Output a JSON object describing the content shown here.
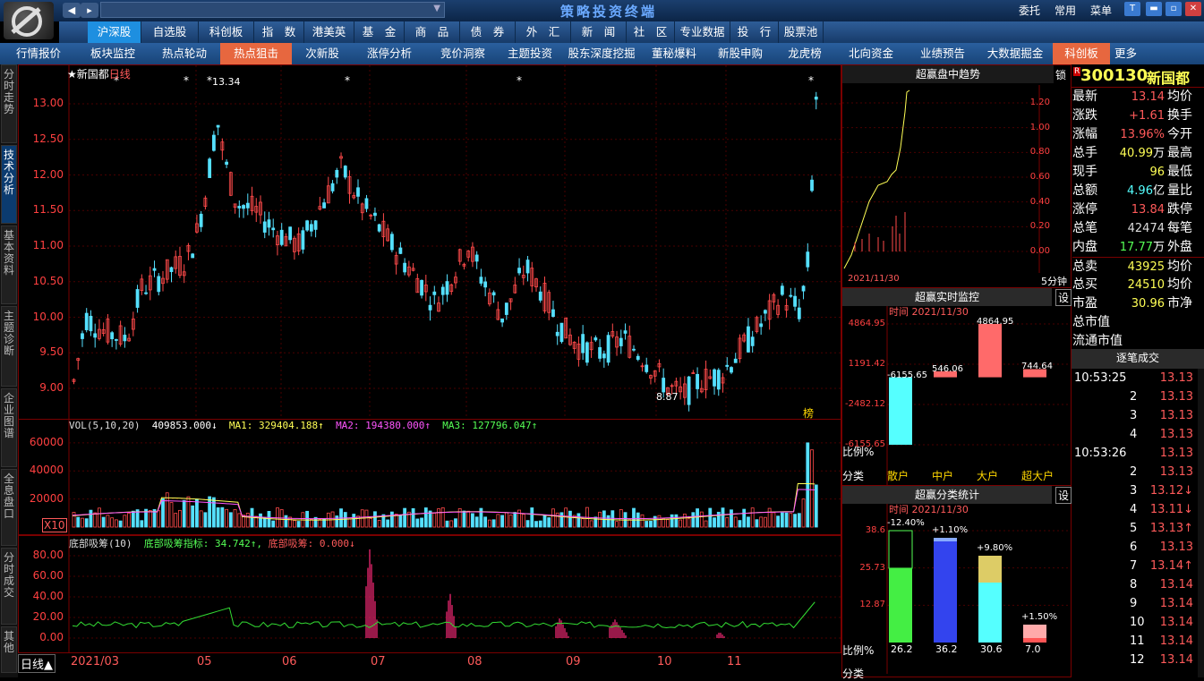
{
  "app": {
    "title": "策略投资终端",
    "right_links": [
      "委托",
      "常用",
      "菜单"
    ]
  },
  "nav1": [
    {
      "label": "沪深股",
      "sel": true
    },
    {
      "label": "自选股"
    },
    {
      "label": "科创板"
    },
    {
      "label": "指　数"
    },
    {
      "label": "港美英"
    },
    {
      "label": "基　金"
    },
    {
      "label": "商　品"
    },
    {
      "label": "债　券"
    },
    {
      "label": "外　汇"
    },
    {
      "label": "新　闻"
    },
    {
      "label": "社　区"
    },
    {
      "label": "专业数据"
    },
    {
      "label": "投　行"
    },
    {
      "label": "股票池"
    }
  ],
  "nav2": [
    {
      "label": "行情报价"
    },
    {
      "label": "板块监控"
    },
    {
      "label": "热点轮动"
    },
    {
      "label": "热点狙击",
      "hot": true
    },
    {
      "label": "次新股"
    },
    {
      "label": "涨停分析"
    },
    {
      "label": "竞价洞察"
    },
    {
      "label": "主题投资"
    },
    {
      "label": "股东深度挖掘"
    },
    {
      "label": "董秘爆料"
    },
    {
      "label": "新股申购"
    },
    {
      "label": "龙虎榜"
    },
    {
      "label": "北向资金"
    },
    {
      "label": "业绩预告"
    },
    {
      "label": "大数据掘金"
    },
    {
      "label": "科创板",
      "hot": true
    },
    {
      "label": "更多"
    }
  ],
  "sidebar": [
    {
      "label": "分时走势"
    },
    {
      "label": "技术分析",
      "sel": true
    },
    {
      "label": "基本资料"
    },
    {
      "label": "主题诊断"
    },
    {
      "label": "企业图谱"
    },
    {
      "label": "全息盘口"
    },
    {
      "label": "分时成交"
    },
    {
      "label": "其他"
    }
  ],
  "kline": {
    "title": "★新国都",
    "period": "日线",
    "high_label": "13.34",
    "low_label": "8.87",
    "yticks": [
      "13.00",
      "12.50",
      "12.00",
      "11.50",
      "11.00",
      "10.50",
      "10.00",
      "9.50",
      "9.00"
    ],
    "bang": "榜"
  },
  "vol": {
    "header": "VOL(5,10,20)",
    "vol_value": "409853.000↓",
    "ma1": "MA1: 329404.188↑",
    "ma2": "MA2: 194380.000↑",
    "ma3": "MA3: 127796.047↑",
    "yticks": [
      "60000",
      "40000",
      "20000"
    ],
    "unit": "X10"
  },
  "dbxc": {
    "header": "底部吸筹(10)",
    "ind1": "底部吸筹指标: 34.742↑,",
    "ind2": "底部吸筹: 0.000↓",
    "yticks": [
      "80.00",
      "60.00",
      "40.00",
      "20.00",
      "0.00"
    ]
  },
  "xaxis": {
    "period": "日线▲",
    "labels": [
      "2021/03",
      "05",
      "06",
      "07",
      "08",
      "09",
      "10",
      "11"
    ]
  },
  "trend": {
    "title": "超赢盘中趋势",
    "lock": "锁",
    "date": "2021/11/30",
    "period": "5分钟",
    "yticks": [
      "1.20",
      "1.00",
      "0.80",
      "0.60",
      "0.40",
      "0.20",
      "0.00"
    ]
  },
  "monitor": {
    "title": "超赢实时监控",
    "setting": "设",
    "time": "时间  2021/11/30",
    "yticks": [
      "4864.95",
      "1191.42",
      "-2482.12",
      "-6155.65"
    ],
    "values": [
      "-6155.65",
      "546.06",
      "4864.95",
      "744.64"
    ],
    "ratio": "比例%",
    "cat": "分类",
    "cats": [
      "散户",
      "中户",
      "大户",
      "超大户"
    ]
  },
  "classstat": {
    "title": "超赢分类统计",
    "setting": "设",
    "time": "时间  2021/11/30",
    "yticks": [
      "38.6",
      "25.73",
      "12.87"
    ],
    "labels": [
      "-12.40%",
      "+1.10%",
      "+9.80%",
      "+1.50%"
    ],
    "ratios": [
      "26.2",
      "36.2",
      "30.6",
      "7.0"
    ],
    "ratio": "比例%",
    "cat": "分类"
  },
  "stock": {
    "code": "300130",
    "name": "新国都",
    "badge": "R"
  },
  "quote": [
    {
      "k": "最新",
      "v": "13.14",
      "c": "#ff5a5a",
      "k2": "均价"
    },
    {
      "k": "涨跌",
      "v": "+1.61",
      "c": "#ff5a5a",
      "k2": "换手"
    },
    {
      "k": "涨幅",
      "v": "13.96%",
      "c": "#ff5a5a",
      "k2": "今开"
    },
    {
      "k": "总手",
      "v": "40.99",
      "u": "万",
      "c": "#ffff55",
      "k2": "最高"
    },
    {
      "k": "现手",
      "v": "96",
      "c": "#ffff55",
      "k2": "最低"
    },
    {
      "k": "总额",
      "v": "4.96",
      "u": "亿",
      "c": "#55ffff",
      "k2": "量比"
    },
    {
      "k": "涨停",
      "v": "13.84",
      "c": "#ff5a5a",
      "k2": "跌停"
    },
    {
      "k": "总笔",
      "v": "42474",
      "c": "#dddddd",
      "k2": "每笔"
    },
    {
      "k": "内盘",
      "v": "17.77",
      "u": "万",
      "c": "#55ff55",
      "k2": "外盘"
    },
    {
      "k": "总卖",
      "v": "43925",
      "c": "#ffff55",
      "k2": "均价"
    },
    {
      "k": "总买",
      "v": "24510",
      "c": "#ffff55",
      "k2": "均价"
    },
    {
      "k": "市盈",
      "v": "30.96",
      "c": "#ffff55",
      "k2": "市净"
    },
    {
      "k": "总市值",
      "v": "",
      "c": "#fff",
      "k2": ""
    },
    {
      "k": "流通市值",
      "v": "",
      "c": "#fff",
      "k2": ""
    }
  ],
  "ticks_title": "逐笔成交",
  "ticks": [
    {
      "t": "10:53:25",
      "p": "13.13"
    },
    {
      "t": "2",
      "p": "13.13"
    },
    {
      "t": "3",
      "p": "13.13"
    },
    {
      "t": "4",
      "p": "13.13"
    },
    {
      "t": "10:53:26",
      "p": "13.13"
    },
    {
      "t": "2",
      "p": "13.13"
    },
    {
      "t": "3",
      "p": "13.12↓"
    },
    {
      "t": "4",
      "p": "13.11↓"
    },
    {
      "t": "5",
      "p": "13.13↑"
    },
    {
      "t": "6",
      "p": "13.13"
    },
    {
      "t": "7",
      "p": "13.14↑"
    },
    {
      "t": "8",
      "p": "13.14"
    },
    {
      "t": "9",
      "p": "13.14"
    },
    {
      "t": "10",
      "p": "13.14"
    },
    {
      "t": "11",
      "p": "13.14"
    },
    {
      "t": "12",
      "p": "13.14"
    }
  ]
}
